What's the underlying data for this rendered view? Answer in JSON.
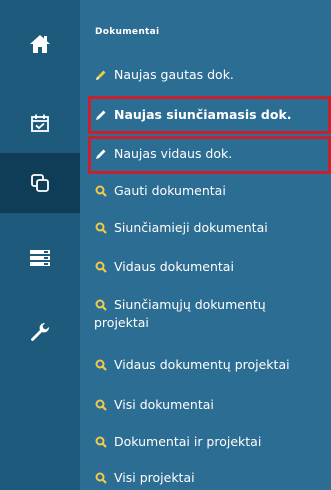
{
  "rail": {
    "items": [
      {
        "icon": "home-icon"
      },
      {
        "icon": "calendar-check-icon"
      },
      {
        "icon": "documents-icon",
        "active": true
      },
      {
        "icon": "list-icon"
      },
      {
        "icon": "wrench-icon"
      }
    ]
  },
  "menu": {
    "section_title": "Dokumentai",
    "items": [
      {
        "label": "Naujas gautas dok.",
        "icon": "pencil-icon"
      },
      {
        "label": "Naujas siunčiamasis dok.",
        "icon": "pencil-icon",
        "highlighted": true
      },
      {
        "label": "Naujas vidaus dok.",
        "icon": "pencil-icon",
        "highlighted": true
      },
      {
        "label": "Gauti dokumentai",
        "icon": "search-icon"
      },
      {
        "label": "Siunčiamieji dokumentai",
        "icon": "search-icon"
      },
      {
        "label": "Vidaus dokumentai",
        "icon": "search-icon"
      },
      {
        "label": "Siunčiamųjų dokumentų projektai",
        "icon": "search-icon"
      },
      {
        "label": "Vidaus dokumentų projektai",
        "icon": "search-icon"
      },
      {
        "label": "Visi dokumentai",
        "icon": "search-icon"
      },
      {
        "label": "Dokumentai ir projektai",
        "icon": "search-icon"
      },
      {
        "label": "Visi projektai",
        "icon": "search-icon"
      }
    ]
  },
  "colors": {
    "rail_bg": "#1e5a7c",
    "rail_active_bg": "#0f3d57",
    "panel_bg": "#2c6d93",
    "highlight_border": "#c8202f",
    "icon_accent": "#f2c94c"
  }
}
